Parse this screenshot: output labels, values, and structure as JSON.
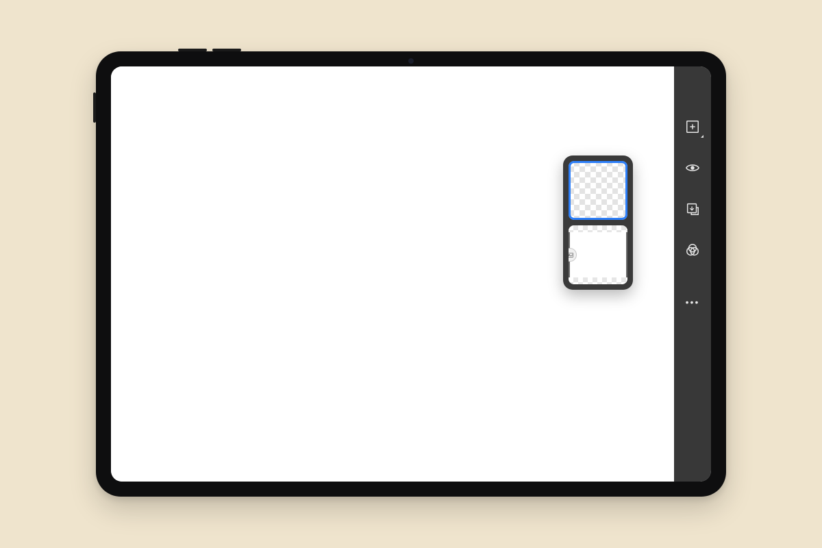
{
  "device": {
    "type": "tablet-landscape"
  },
  "canvas": {
    "background": "#ffffff"
  },
  "toolbar": {
    "buttons": [
      {
        "name": "add-layer",
        "icon": "plus-square-icon",
        "has_flyout": true
      },
      {
        "name": "layer-visibility",
        "icon": "eye-icon",
        "has_flyout": false
      },
      {
        "name": "layer-properties",
        "icon": "layer-down-icon",
        "has_flyout": false
      },
      {
        "name": "blend-mode",
        "icon": "venn-icon",
        "has_flyout": false
      }
    ],
    "more_label": "•••"
  },
  "layers_popover": {
    "open": true,
    "layers": [
      {
        "id": "layer-1",
        "selected": true,
        "transparent": true
      },
      {
        "id": "background",
        "selected": false,
        "transparent": false,
        "badge": "image-icon"
      }
    ]
  }
}
